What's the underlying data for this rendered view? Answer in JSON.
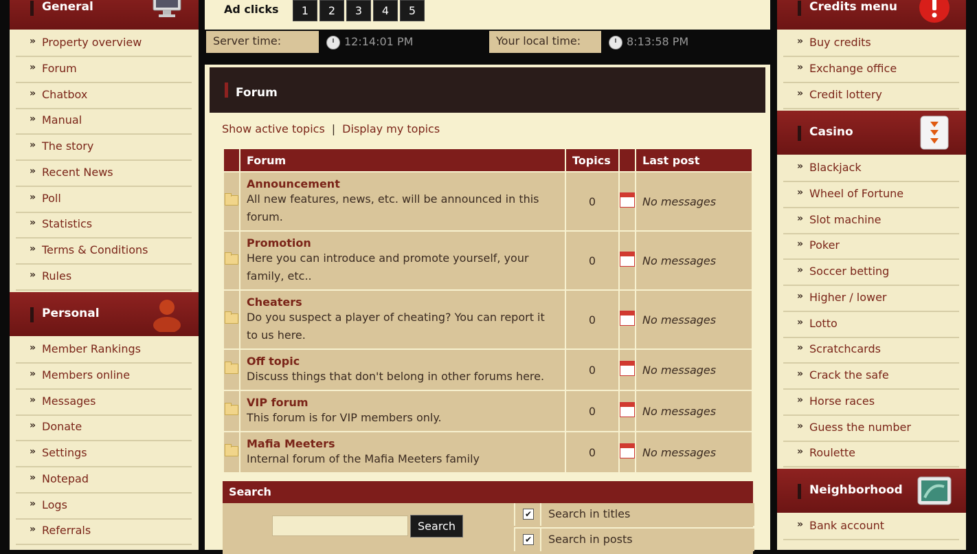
{
  "left": {
    "general": {
      "title": "General",
      "items": [
        "Property overview",
        "Forum",
        "Chatbox",
        "Manual",
        "The story",
        "Recent News",
        "Poll",
        "Statistics",
        "Terms & Conditions",
        "Rules"
      ]
    },
    "personal": {
      "title": "Personal",
      "items": [
        "Member Rankings",
        "Members online",
        "Messages",
        "Donate",
        "Settings",
        "Notepad",
        "Logs",
        "Referrals"
      ]
    }
  },
  "right": {
    "credits": {
      "title": "Credits menu",
      "items": [
        "Buy credits",
        "Exchange office",
        "Credit lottery"
      ]
    },
    "casino": {
      "title": "Casino",
      "items": [
        "Blackjack",
        "Wheel of Fortune",
        "Slot machine",
        "Poker",
        "Soccer betting",
        "Higher / lower",
        "Lotto",
        "Scratchcards",
        "Crack the safe",
        "Horse races",
        "Guess the number",
        "Roulette"
      ]
    },
    "neighborhood": {
      "title": "Neighborhood",
      "items": [
        "Bank account"
      ]
    }
  },
  "chevron": "»",
  "ad": {
    "label": "Ad clicks",
    "buttons": [
      "1",
      "2",
      "3",
      "4",
      "5"
    ]
  },
  "time": {
    "server_label": "Server time:",
    "server_value": "12:14:01 PM",
    "local_label": "Your local time:",
    "local_value": "8:13:58 PM"
  },
  "forum": {
    "title": "Forum",
    "link_active": "Show active topics",
    "separator": "|",
    "link_mine": "Display my topics",
    "headers": {
      "forum": "Forum",
      "topics": "Topics",
      "last": "Last post"
    },
    "rows": [
      {
        "name": "Announcement",
        "desc": "All new features, news, etc. will be announced in this forum.",
        "topics": "0",
        "last": "No messages"
      },
      {
        "name": "Promotion",
        "desc": "Here you can introduce and promote yourself, your family, etc..",
        "topics": "0",
        "last": "No messages"
      },
      {
        "name": "Cheaters",
        "desc": "Do you suspect a player of cheating? You can report it to us here.",
        "topics": "0",
        "last": "No messages"
      },
      {
        "name": "Off topic",
        "desc": "Discuss things that don't belong in other forums here.",
        "topics": "0",
        "last": "No messages"
      },
      {
        "name": "VIP forum",
        "desc": "This forum is for VIP members only.",
        "topics": "0",
        "last": "No messages"
      },
      {
        "name": "Mafia Meeters",
        "desc": "Internal forum of the Mafia Meeters family",
        "topics": "0",
        "last": "No messages"
      }
    ]
  },
  "search": {
    "title": "Search",
    "button": "Search",
    "input_value": "",
    "options": [
      {
        "label": "Search in titles",
        "checked": true
      },
      {
        "label": "Search in posts",
        "checked": true
      }
    ],
    "check_glyph": "✔"
  },
  "colors": {
    "header_red": "#7e1d1b",
    "panel_bg": "#f3ecc9",
    "cell_bg": "#d9c59a",
    "link": "#7a2418"
  }
}
